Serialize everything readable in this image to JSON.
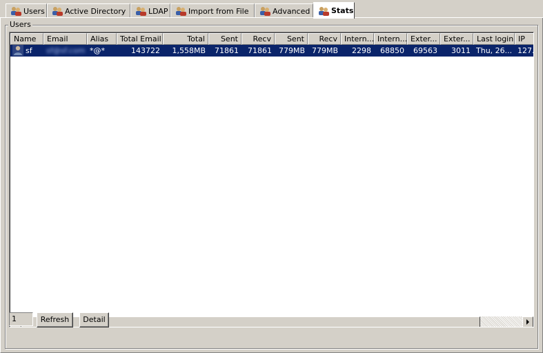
{
  "tabs": [
    {
      "label": "Users",
      "active": false
    },
    {
      "label": "Active Directory",
      "active": false
    },
    {
      "label": "LDAP",
      "active": false
    },
    {
      "label": "Import from File",
      "active": false
    },
    {
      "label": "Advanced",
      "active": false
    },
    {
      "label": "Stats",
      "active": true
    }
  ],
  "group": {
    "title": "Users"
  },
  "table": {
    "columns": [
      "Name",
      "Email",
      "Alias",
      "Total Email",
      "Total",
      "Sent",
      "Recv",
      "Sent",
      "Recv",
      "Intern...",
      "Intern...",
      "Exter...",
      "Exter...",
      "Last login",
      "IP"
    ],
    "rows": [
      {
        "name": "sf",
        "email": "sf@sf.com",
        "alias": "*@*",
        "total_email": "143722",
        "total": "1,558MB",
        "sent_count": "71861",
        "recv_count": "71861",
        "sent_size": "779MB",
        "recv_size": "779MB",
        "intern_1": "2298",
        "intern_2": "68850",
        "exter_1": "69563",
        "exter_2": "3011",
        "last_login": "Thu, 26...",
        "ip": "127."
      }
    ]
  },
  "footer": {
    "count": "1",
    "refresh_label": "Refresh",
    "detail_label": "Detail"
  },
  "colors": {
    "selection": "#0a246a",
    "face": "#d4d0c8"
  },
  "icons": {
    "tab": "users-icon",
    "row": "user-icon"
  }
}
